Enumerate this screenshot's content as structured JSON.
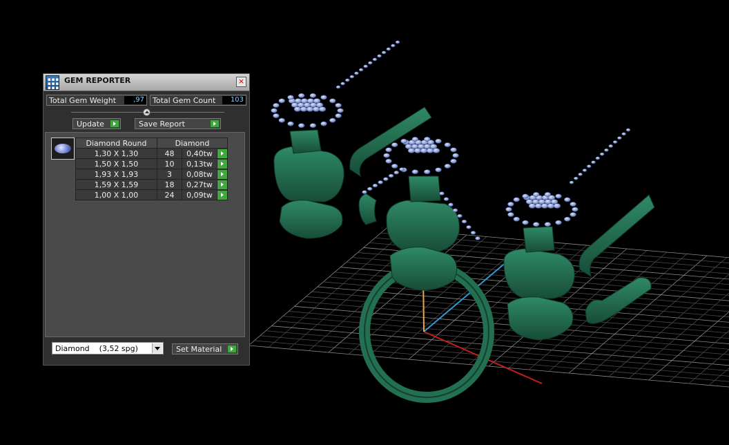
{
  "window": {
    "title": "GEM REPORTER",
    "close_glyph": "×"
  },
  "stats": {
    "total_weight_label": "Total Gem Weight",
    "total_weight_value": ",97",
    "total_count_label": "Total Gem Count",
    "total_count_value": "103"
  },
  "toolbar": {
    "update_label": "Update",
    "save_report_label": "Save Report"
  },
  "gem_table": {
    "headers": [
      "Diamond Round",
      "Diamond"
    ],
    "rows": [
      {
        "size": "1,30 X 1,30",
        "count": "48",
        "weight": "0,40tw"
      },
      {
        "size": "1,50 X 1,50",
        "count": "10",
        "weight": "0,13tw"
      },
      {
        "size": "1,93 X 1,93",
        "count": "3",
        "weight": "0,08tw"
      },
      {
        "size": "1,59 X 1,59",
        "count": "18",
        "weight": "0,27tw"
      },
      {
        "size": "1,00 X 1,00",
        "count": "24",
        "weight": "0,09tw"
      }
    ]
  },
  "material": {
    "selected": "Diamond    (3,52 spg)",
    "set_label": "Set Material"
  },
  "colors": {
    "background": "#000000",
    "ring_green": "#1f6b4f",
    "gem_blue": "#8fa2d6",
    "accent_green": "#3fa83f"
  },
  "icons": [
    "gem-reporter-app-icon",
    "close-icon",
    "slider-collapse-icon",
    "play-arrow-icon",
    "dropdown-arrow-icon",
    "gem-thumbnail-icon"
  ]
}
